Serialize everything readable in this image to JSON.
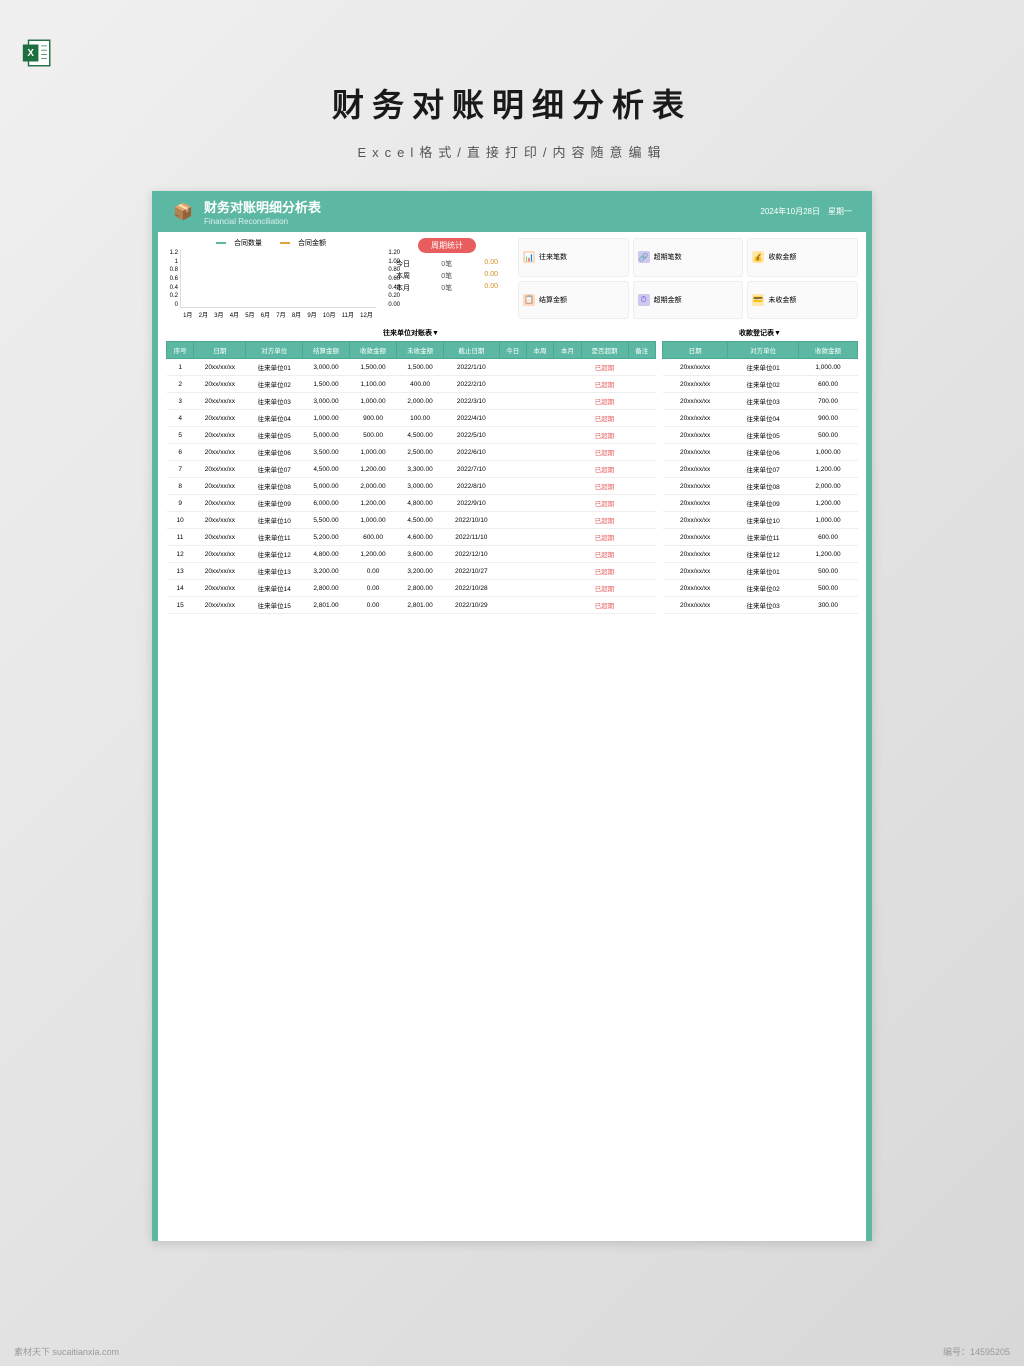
{
  "page": {
    "title": "财务对账明细分析表",
    "subtitle": "Excel格式/直接打印/内容随意编辑"
  },
  "sheet_header": {
    "title": "财务对账明细分析表",
    "subtitle_en": "Financial Reconciliation",
    "date": "2024年10月28日　星期一"
  },
  "chart_data": {
    "type": "bar",
    "legend": [
      "合同数量",
      "合同金额"
    ],
    "y_left": [
      "1.2",
      "1",
      "0.8",
      "0.6",
      "0.4",
      "0.2",
      "0"
    ],
    "y_right": [
      "1.20",
      "1.00",
      "0.80",
      "0.60",
      "0.40",
      "0.20",
      "0.00"
    ],
    "x": [
      "1月",
      "2月",
      "3月",
      "4月",
      "5月",
      "6月",
      "7月",
      "8月",
      "9月",
      "10月",
      "11月",
      "12月"
    ],
    "values": [
      0,
      0,
      0,
      0,
      0,
      0,
      0,
      0,
      0,
      0,
      0,
      0
    ]
  },
  "period_stats": {
    "pill": "周期统计",
    "rows": [
      {
        "label": "今日",
        "count": "0笔",
        "amount": "0.00"
      },
      {
        "label": "本周",
        "count": "0笔",
        "amount": "0.00"
      },
      {
        "label": "本月",
        "count": "0笔",
        "amount": "0.00"
      }
    ]
  },
  "cards": [
    {
      "icon": "📊",
      "cls": "ci1",
      "label": "往来笔数"
    },
    {
      "icon": "🔗",
      "cls": "ci2",
      "label": "超期笔数"
    },
    {
      "icon": "💰",
      "cls": "ci3",
      "label": "收款金额"
    },
    {
      "icon": "📋",
      "cls": "ci1",
      "label": "结算金额"
    },
    {
      "icon": "⏱",
      "cls": "ci2",
      "label": "超期金额"
    },
    {
      "icon": "💳",
      "cls": "ci3",
      "label": "未收金额"
    }
  ],
  "table_left": {
    "caption": "往来单位对账表▼",
    "headers": [
      "序号",
      "日期",
      "对方单位",
      "结算金额",
      "收款金额",
      "未收金额",
      "截止日期",
      "今日",
      "本周",
      "本月",
      "是否超期",
      "备注"
    ],
    "rows": [
      [
        "1",
        "20xx/xx/xx",
        "往来单位01",
        "3,000.00",
        "1,500.00",
        "1,500.00",
        "2022/1/10",
        "",
        "",
        "",
        "已超期",
        ""
      ],
      [
        "2",
        "20xx/xx/xx",
        "往来单位02",
        "1,500.00",
        "1,100.00",
        "400.00",
        "2022/2/10",
        "",
        "",
        "",
        "已超期",
        ""
      ],
      [
        "3",
        "20xx/xx/xx",
        "往来单位03",
        "3,000.00",
        "1,000.00",
        "2,000.00",
        "2022/3/10",
        "",
        "",
        "",
        "已超期",
        ""
      ],
      [
        "4",
        "20xx/xx/xx",
        "往来单位04",
        "1,000.00",
        "900.00",
        "100.00",
        "2022/4/10",
        "",
        "",
        "",
        "已超期",
        ""
      ],
      [
        "5",
        "20xx/xx/xx",
        "往来单位05",
        "5,000.00",
        "500.00",
        "4,500.00",
        "2022/5/10",
        "",
        "",
        "",
        "已超期",
        ""
      ],
      [
        "6",
        "20xx/xx/xx",
        "往来单位06",
        "3,500.00",
        "1,000.00",
        "2,500.00",
        "2022/6/10",
        "",
        "",
        "",
        "已超期",
        ""
      ],
      [
        "7",
        "20xx/xx/xx",
        "往来单位07",
        "4,500.00",
        "1,200.00",
        "3,300.00",
        "2022/7/10",
        "",
        "",
        "",
        "已超期",
        ""
      ],
      [
        "8",
        "20xx/xx/xx",
        "往来单位08",
        "5,000.00",
        "2,000.00",
        "3,000.00",
        "2022/8/10",
        "",
        "",
        "",
        "已超期",
        ""
      ],
      [
        "9",
        "20xx/xx/xx",
        "往来单位09",
        "6,000.00",
        "1,200.00",
        "4,800.00",
        "2022/9/10",
        "",
        "",
        "",
        "已超期",
        ""
      ],
      [
        "10",
        "20xx/xx/xx",
        "往来单位10",
        "5,500.00",
        "1,000.00",
        "4,500.00",
        "2022/10/10",
        "",
        "",
        "",
        "已超期",
        ""
      ],
      [
        "11",
        "20xx/xx/xx",
        "往来单位11",
        "5,200.00",
        "600.00",
        "4,600.00",
        "2022/11/10",
        "",
        "",
        "",
        "已超期",
        ""
      ],
      [
        "12",
        "20xx/xx/xx",
        "往来单位12",
        "4,800.00",
        "1,200.00",
        "3,600.00",
        "2022/12/10",
        "",
        "",
        "",
        "已超期",
        ""
      ],
      [
        "13",
        "20xx/xx/xx",
        "往来单位13",
        "3,200.00",
        "0.00",
        "3,200.00",
        "2022/10/27",
        "",
        "",
        "",
        "已超期",
        ""
      ],
      [
        "14",
        "20xx/xx/xx",
        "往来单位14",
        "2,800.00",
        "0.00",
        "2,800.00",
        "2022/10/28",
        "",
        "",
        "",
        "已超期",
        ""
      ],
      [
        "15",
        "20xx/xx/xx",
        "往来单位15",
        "2,801.00",
        "0.00",
        "2,801.00",
        "2022/10/29",
        "",
        "",
        "",
        "已超期",
        ""
      ]
    ]
  },
  "table_right": {
    "caption": "收款登记表▼",
    "headers": [
      "日期",
      "对方单位",
      "收款金额"
    ],
    "rows": [
      [
        "20xx/xx/xx",
        "往来单位01",
        "1,000.00"
      ],
      [
        "20xx/xx/xx",
        "往来单位02",
        "600.00"
      ],
      [
        "20xx/xx/xx",
        "往来单位03",
        "700.00"
      ],
      [
        "20xx/xx/xx",
        "往来单位04",
        "900.00"
      ],
      [
        "20xx/xx/xx",
        "往来单位05",
        "500.00"
      ],
      [
        "20xx/xx/xx",
        "往来单位06",
        "1,000.00"
      ],
      [
        "20xx/xx/xx",
        "往来单位07",
        "1,200.00"
      ],
      [
        "20xx/xx/xx",
        "往来单位08",
        "2,000.00"
      ],
      [
        "20xx/xx/xx",
        "往来单位09",
        "1,200.00"
      ],
      [
        "20xx/xx/xx",
        "往来单位10",
        "1,000.00"
      ],
      [
        "20xx/xx/xx",
        "往来单位11",
        "600.00"
      ],
      [
        "20xx/xx/xx",
        "往来单位12",
        "1,200.00"
      ],
      [
        "20xx/xx/xx",
        "往来单位01",
        "500.00"
      ],
      [
        "20xx/xx/xx",
        "往来单位02",
        "500.00"
      ],
      [
        "20xx/xx/xx",
        "往来单位03",
        "300.00"
      ]
    ]
  },
  "footer": {
    "watermark": "素材天下 sucaitianxia.com",
    "id_label": "编号：",
    "id": "14595205"
  }
}
